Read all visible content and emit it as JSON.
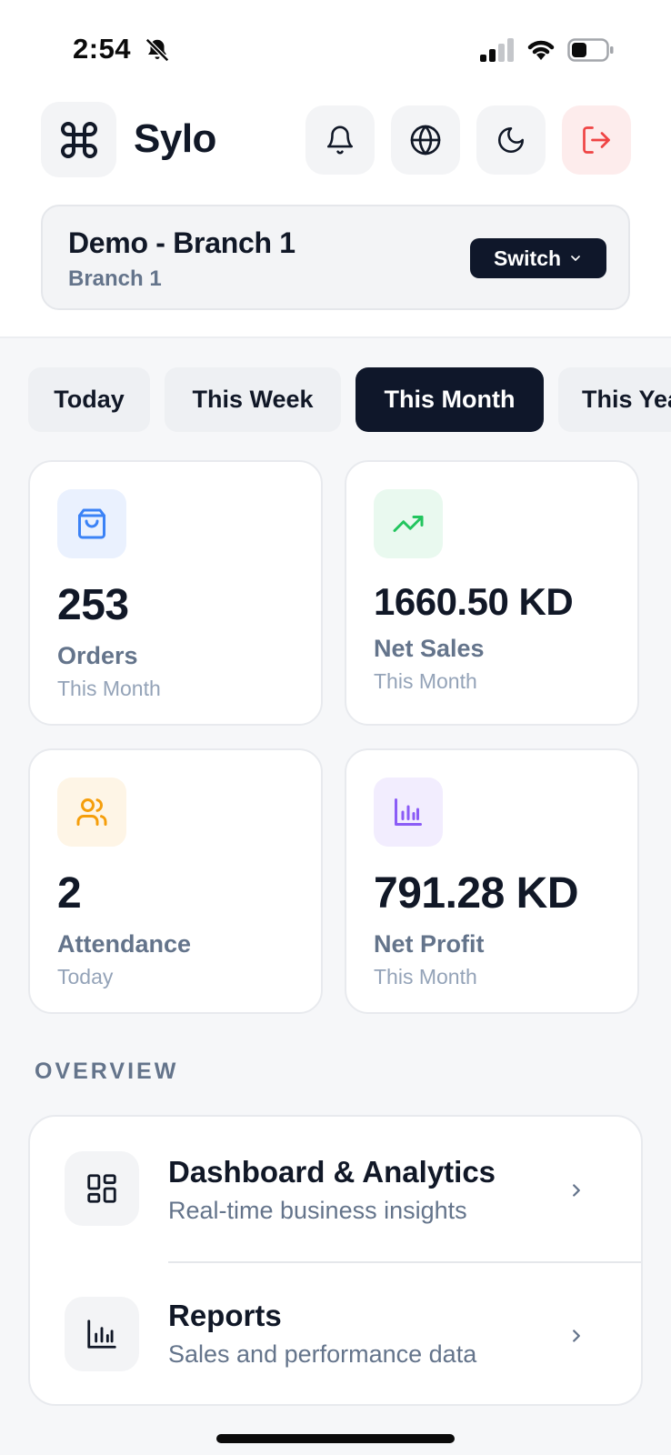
{
  "status_bar": {
    "time": "2:54",
    "icons": [
      "bell-slash-icon",
      "cellular-signal-icon",
      "wifi-icon",
      "battery-icon"
    ]
  },
  "header": {
    "brand": "Sylo",
    "logo_icon": "command-icon",
    "actions": [
      {
        "name": "notifications",
        "icon": "bell-icon"
      },
      {
        "name": "language",
        "icon": "globe-icon"
      },
      {
        "name": "theme",
        "icon": "moon-icon"
      },
      {
        "name": "logout",
        "icon": "logout-icon",
        "color": "#ef4444"
      }
    ]
  },
  "branch": {
    "name": "Demo - Branch 1",
    "subtitle": "Branch 1",
    "switch_label": "Switch"
  },
  "period_tabs": [
    {
      "label": "Today",
      "active": false
    },
    {
      "label": "This Week",
      "active": false
    },
    {
      "label": "This Month",
      "active": true
    },
    {
      "label": "This Year",
      "active": false
    }
  ],
  "stats": [
    {
      "value": "253",
      "label": "Orders",
      "period": "This Month",
      "icon": "shopping-bag-icon",
      "color": "#3b82f6",
      "bg": "#eaf1fe"
    },
    {
      "value": "1660.50 KD",
      "label": "Net Sales",
      "period": "This Month",
      "icon": "trending-up-icon",
      "color": "#22c55e",
      "bg": "#e9f9ef"
    },
    {
      "value": "2",
      "label": "Attendance",
      "period": "Today",
      "icon": "users-icon",
      "color": "#f59e0b",
      "bg": "#fef5e6"
    },
    {
      "value": "791.28 KD",
      "label": "Net Profit",
      "period": "This Month",
      "icon": "bar-chart-icon",
      "color": "#8b5cf6",
      "bg": "#f2edfe"
    }
  ],
  "overview": {
    "title": "OVERVIEW",
    "items": [
      {
        "title": "Dashboard & Analytics",
        "subtitle": "Real-time business insights",
        "icon": "dashboard-grid-icon"
      },
      {
        "title": "Reports",
        "subtitle": "Sales and performance data",
        "icon": "bar-chart-icon"
      }
    ]
  }
}
